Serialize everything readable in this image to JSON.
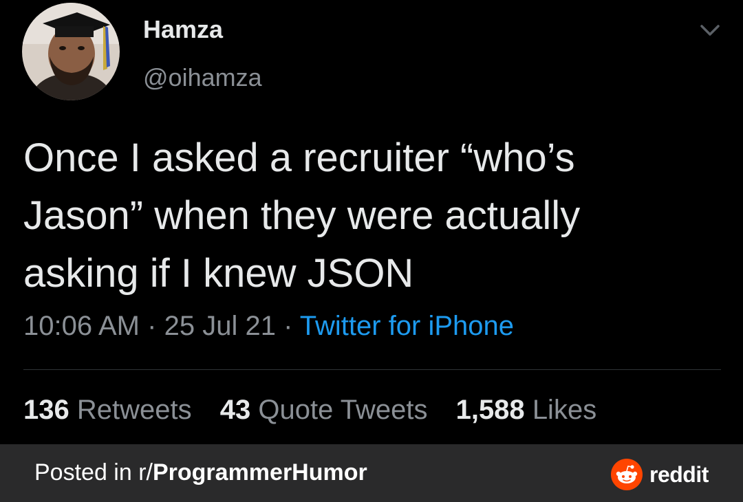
{
  "tweet": {
    "author_name": "Hamza",
    "author_handle": "@oihamza",
    "text_lines": [
      "Once I asked a recruiter “who’s",
      "Jason” when they were actually",
      "asking if I knew JSON"
    ],
    "time": "10:06 AM",
    "date": "25 Jul 21",
    "separator": "·",
    "source": "Twitter for iPhone",
    "stats": {
      "retweets_count": "136",
      "retweets_label": "Retweets",
      "quotes_count": "43",
      "quotes_label": "Quote Tweets",
      "likes_count": "1,588",
      "likes_label": "Likes"
    }
  },
  "footer": {
    "posted_prefix": "Posted in r/",
    "subreddit": "ProgrammerHumor",
    "brand": "reddit"
  },
  "icons": {
    "menu": "chevron-down-icon",
    "brand": "reddit-logo-icon"
  },
  "colors": {
    "background": "#000000",
    "link": "#1d9bf0",
    "muted": "#8b9096",
    "footer_bg": "#2a2a2b",
    "reddit_orange": "#ff4500"
  }
}
